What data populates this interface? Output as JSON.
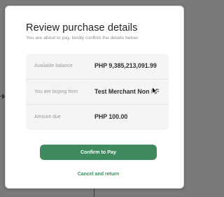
{
  "modal": {
    "title": "Review purchase details",
    "subtitle": "You are about to pay, kindly confirm the details below."
  },
  "details": {
    "rows": [
      {
        "label": "Available balance",
        "value": "PHP 9,385,213,091.99"
      },
      {
        "label": "You are buying from",
        "value": "Test Merchant Non PF"
      },
      {
        "label": "Amount due",
        "value": "PHP 100.00"
      }
    ]
  },
  "actions": {
    "confirm_label": "Confirm to Pay",
    "cancel_label": "Cancel and return"
  },
  "colors": {
    "accent": "#3f8a5f",
    "backdrop": "#7a7a7a",
    "panel": "#f4f4f4"
  }
}
